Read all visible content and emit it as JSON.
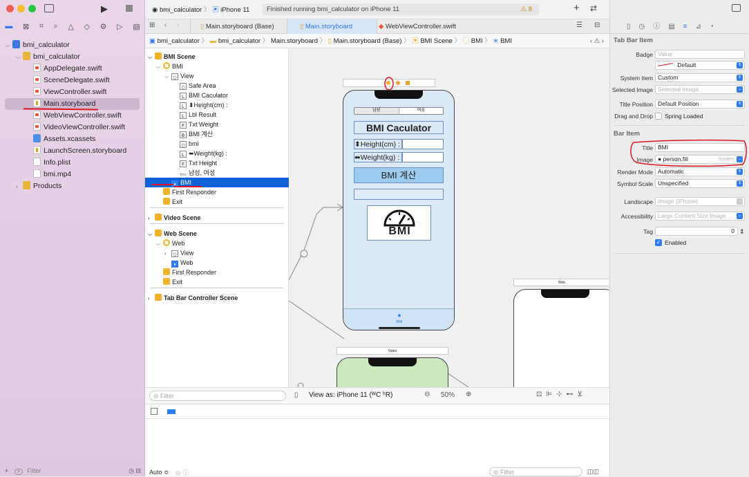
{
  "window": {
    "traffic_lights": [
      "#ee5f57",
      "#f5bd2f",
      "#29c740"
    ]
  },
  "toolbar": {
    "scheme": "bmi_calculator",
    "device": "iPhone 11",
    "status": "Finished running bmi_calculator on iPhone 11",
    "warning_count": "8"
  },
  "editor_tabs": [
    {
      "label": "Main.storyboard (Base)"
    },
    {
      "label": "Main.storyboard"
    },
    {
      "label": "WebViewController.swift"
    }
  ],
  "jump_bar": [
    "bmi_calculator",
    "bmi_calculator",
    "Main.storyboard",
    "Main.storyboard (Base)",
    "BMI Scene",
    "BMI",
    "BMI"
  ],
  "navigator": {
    "items": [
      {
        "label": "bmi_calculator",
        "kind": "proj",
        "indent": 0,
        "disc": "v"
      },
      {
        "label": "bmi_calculator",
        "kind": "folder",
        "indent": 1,
        "disc": "v"
      },
      {
        "label": "AppDelegate.swift",
        "kind": "swift",
        "indent": 2
      },
      {
        "label": "SceneDelegate.swift",
        "kind": "swift",
        "indent": 2
      },
      {
        "label": "ViewController.swift",
        "kind": "swift",
        "indent": 2
      },
      {
        "label": "Main.storyboard",
        "kind": "sb",
        "indent": 2,
        "selected": true
      },
      {
        "label": "WebViewController.swift",
        "kind": "swift",
        "indent": 2
      },
      {
        "label": "VideoViewController.swift",
        "kind": "swift",
        "indent": 2
      },
      {
        "label": "Assets.xcassets",
        "kind": "asset",
        "indent": 2
      },
      {
        "label": "LaunchScreen.storyboard",
        "kind": "sb",
        "indent": 2
      },
      {
        "label": "Info.plist",
        "kind": "plist",
        "indent": 2
      },
      {
        "label": "bmi.mp4",
        "kind": "mp4",
        "indent": 2
      },
      {
        "label": "Products",
        "kind": "folder",
        "indent": 1,
        "disc": ">"
      }
    ],
    "filter_placeholder": "Filter"
  },
  "outline": {
    "rows": [
      {
        "label": "BMI Scene",
        "icon": "y",
        "indent": 0,
        "disc": "v",
        "bold": true
      },
      {
        "label": "BMI",
        "icon": "yc",
        "indent": 1,
        "disc": "v"
      },
      {
        "label": "View",
        "icon": "box",
        "indent": 2,
        "disc": "v"
      },
      {
        "label": "Safe Area",
        "icon": "box",
        "indent": 3
      },
      {
        "label": "BMI Caculator",
        "icon": "L",
        "indent": 3
      },
      {
        "label": "⬍Height(cm) :",
        "icon": "L",
        "indent": 3
      },
      {
        "label": "Lbl Result",
        "icon": "L",
        "indent": 3
      },
      {
        "label": "Txt Weight",
        "icon": "F",
        "indent": 3
      },
      {
        "label": "BMI 계산",
        "icon": "B",
        "indent": 3
      },
      {
        "label": "bmi",
        "icon": "box",
        "indent": 3
      },
      {
        "label": "⬌Weight(kg) :",
        "icon": "L",
        "indent": 3
      },
      {
        "label": "Txt Height",
        "icon": "F",
        "indent": 3
      },
      {
        "label": "남성, 여성",
        "icon": "seg",
        "indent": 3
      },
      {
        "label": "BMI",
        "icon": "star",
        "indent": 2,
        "selected": true
      },
      {
        "label": "First Responder",
        "icon": "y",
        "indent": 1
      },
      {
        "label": "Exit",
        "icon": "y",
        "indent": 1
      },
      {
        "label": "Video Scene",
        "icon": "y",
        "indent": 0,
        "disc": ">",
        "bold": true,
        "gap": true
      },
      {
        "label": "Web Scene",
        "icon": "y",
        "indent": 0,
        "disc": "v",
        "bold": true,
        "gap": true
      },
      {
        "label": "Web",
        "icon": "yc",
        "indent": 1,
        "disc": "v"
      },
      {
        "label": "View",
        "icon": "box",
        "indent": 2,
        "disc": ">"
      },
      {
        "label": "Web",
        "icon": "star",
        "indent": 2
      },
      {
        "label": "First Responder",
        "icon": "y",
        "indent": 1
      },
      {
        "label": "Exit",
        "icon": "y",
        "indent": 1
      },
      {
        "label": "Tab Bar Controller Scene",
        "icon": "y",
        "indent": 0,
        "disc": ">",
        "bold": true,
        "gap": true
      }
    ],
    "filter_placeholder": "Filter"
  },
  "canvas": {
    "phone": {
      "segments": [
        "남성",
        "여성"
      ],
      "title": "BMI Caculator",
      "height_label": "⬍Height(cm) :",
      "weight_label": "⬌Weight(kg) :",
      "calc_button": "BMI 계산",
      "bmi_logo_text": "BMI",
      "tab_label": "BMI"
    },
    "web_scene_title": "Web",
    "video_scene_title": "Video",
    "view_as": "View as: iPhone 11 (ᵂC ʰR)",
    "zoom": "50%"
  },
  "inspector": {
    "tab_bar_item_header": "Tab Bar Item",
    "badge_label": "Badge",
    "badge_placeholder": "Value",
    "badge_color": "Default",
    "system_item_label": "System Item",
    "system_item": "Custom",
    "selected_image_label": "Selected Image",
    "selected_image_placeholder": "Selected Image",
    "title_position_label": "Title Position",
    "title_position": "Default Position",
    "drag_drop_label": "Drag and Drop",
    "spring_loaded": "Spring Loaded",
    "bar_item_header": "Bar Item",
    "title_label": "Title",
    "title_value": "BMI",
    "image_label": "Image",
    "image_value": "person.fill",
    "image_source": "System",
    "render_mode_label": "Render Mode",
    "render_mode": "Automatic",
    "symbol_scale_label": "Symbol Scale",
    "symbol_scale": "Unspecified",
    "landscape_label": "Landscape",
    "landscape_placeholder": "Image (iPhone)",
    "accessibility_label": "Accessibility",
    "accessibility_placeholder": "Large Content Size Image",
    "tag_label": "Tag",
    "tag_value": "0",
    "enabled_label": "Enabled"
  },
  "debug": {
    "auto_label": "Auto ≎",
    "filter_placeholder": "Filter"
  },
  "colors": {
    "selection": "#0a63d6",
    "annotation_red": "#e0141e",
    "accent": "#2f7cf6"
  }
}
